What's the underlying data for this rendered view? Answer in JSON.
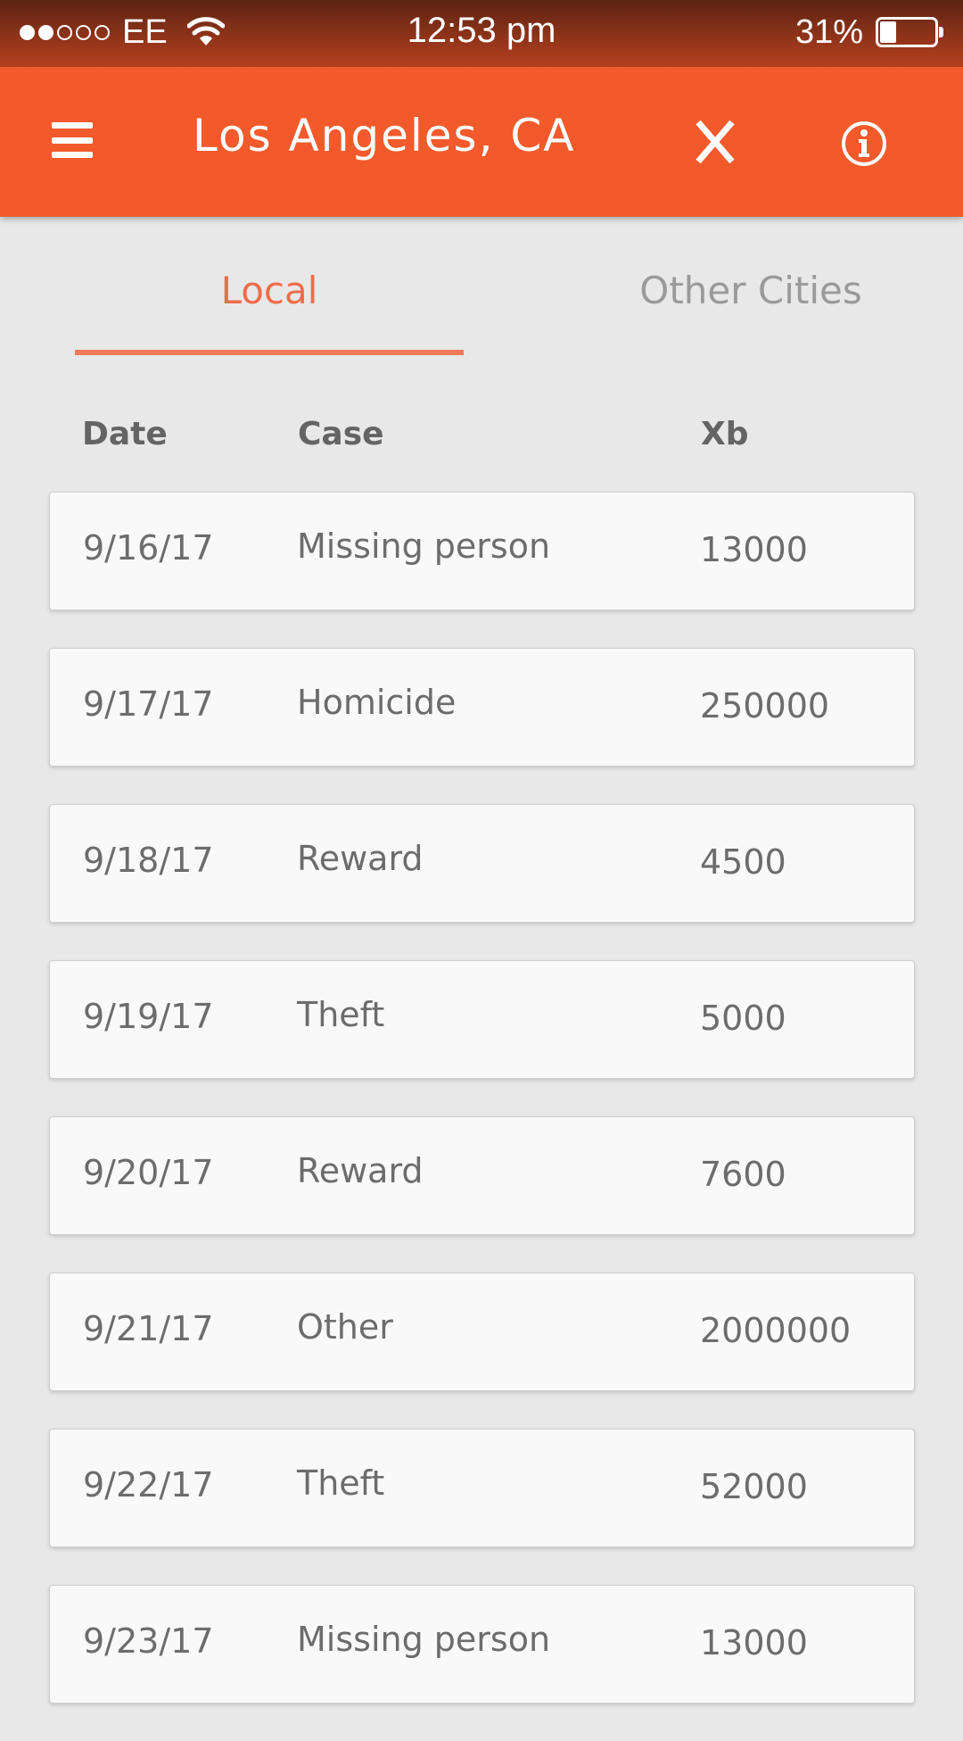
{
  "status_bar": {
    "carrier": "EE",
    "time": "12:53 pm",
    "battery": "31%",
    "battery_level": 0.31,
    "signal_bars_filled": 2,
    "signal_bars_total": 5
  },
  "app_bar": {
    "title": "Los Angeles, CA",
    "menu_icon": "hamburger-menu-icon",
    "close_icon": "close-x-icon",
    "info_icon": "info-circle-icon",
    "background_color": "#f25a2c"
  },
  "tabs": [
    {
      "label": "Local",
      "active": true
    },
    {
      "label": "Other Cities",
      "active": false
    }
  ],
  "accent_color": "#ef6d4b",
  "table": {
    "columns": [
      "Date",
      "Case",
      "Xb"
    ],
    "rows": [
      {
        "date": "9/16/17",
        "case": "Missing person",
        "xb": "13000"
      },
      {
        "date": "9/17/17",
        "case": "Homicide",
        "xb": "250000"
      },
      {
        "date": "9/18/17",
        "case": "Reward",
        "xb": "4500"
      },
      {
        "date": "9/19/17",
        "case": "Theft",
        "xb": "5000"
      },
      {
        "date": "9/20/17",
        "case": "Reward",
        "xb": "7600"
      },
      {
        "date": "9/21/17",
        "case": "Other",
        "xb": "2000000"
      },
      {
        "date": "9/22/17",
        "case": "Theft",
        "xb": "52000"
      },
      {
        "date": "9/23/17",
        "case": "Missing person",
        "xb": "13000"
      }
    ]
  }
}
